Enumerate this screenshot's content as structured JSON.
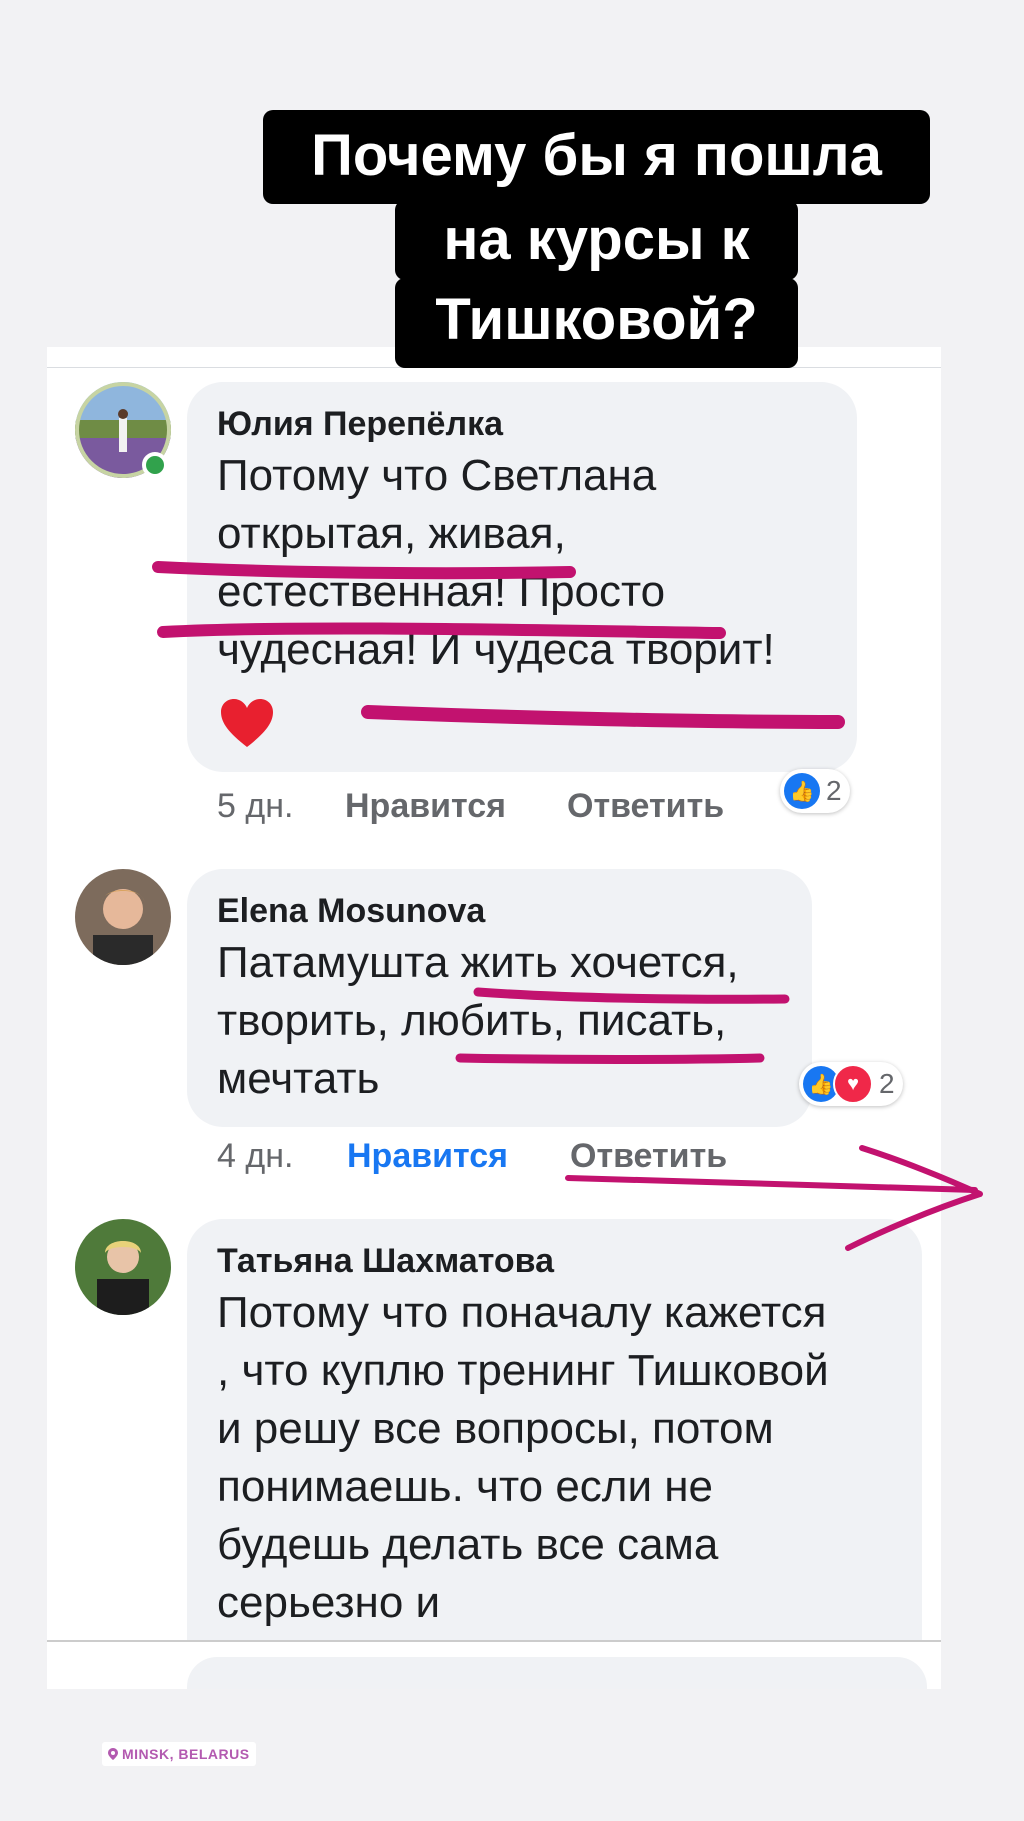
{
  "headline": {
    "line1": "Почему бы я пошла",
    "line2": "на курсы к",
    "line3": "Тишковой?"
  },
  "comments": [
    {
      "author": "Юлия Перепёлка",
      "lines": [
        "Потому что Светлана",
        "открытая, живая,",
        "естественная! Просто",
        "чудесная! И чудеса творит!"
      ],
      "emoji": "❤️",
      "time": "5 дн.",
      "like_label": "Нравится",
      "reply_label": "Ответить",
      "reaction_count": "2",
      "liked": false
    },
    {
      "author": "Elena Mosunova",
      "lines": [
        "Патамушта жить хочется,",
        "творить, любить, писать,",
        "мечтать"
      ],
      "time": "4 дн.",
      "like_label": "Нравится",
      "reply_label": "Ответить",
      "reaction_count": "2",
      "liked": true
    },
    {
      "author": "Татьяна Шахматова",
      "lines": [
        "Потому что поначалу кажется",
        ", что куплю тренинг Тишковой",
        "и решу все вопросы, потом",
        "понимаешь. что если не",
        "будешь делать все сама",
        "серьезно и"
      ]
    }
  ],
  "location": "MINSK, BELARUS",
  "colors": {
    "marker": "#c2126f",
    "like_blue": "#1877f2",
    "love_red": "#f02849",
    "bubble": "#f0f2f5"
  },
  "icons": [
    "like-reaction-icon",
    "love-reaction-icon",
    "heart-emoji-icon",
    "location-pin-icon"
  ]
}
